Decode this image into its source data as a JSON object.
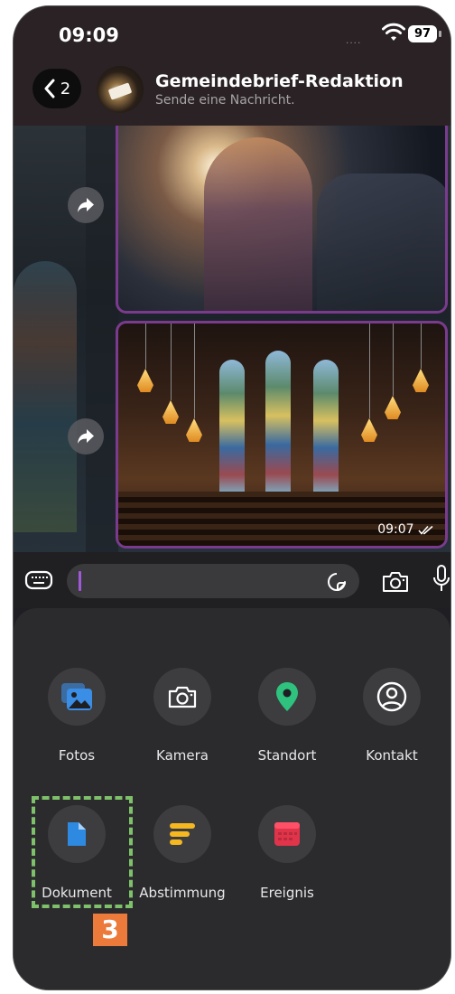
{
  "status_bar": {
    "time": "09:09",
    "signal": "....",
    "battery": "97"
  },
  "header": {
    "back_count": "2",
    "title": "Gemeindebrief-Redaktion",
    "subtitle": "Sende eine Nachricht."
  },
  "messages": [
    {
      "type": "photo",
      "description_icon": "forward-icon"
    },
    {
      "type": "photo",
      "time": "09:07",
      "read_status": "double-check-icon"
    }
  ],
  "input": {
    "value": "",
    "keyboard_icon": "keyboard-icon",
    "sticker_icon": "sticker-icon",
    "camera_icon": "camera-icon",
    "mic_icon": "microphone-icon"
  },
  "attachments": [
    {
      "label": "Fotos",
      "icon": "photos-icon",
      "color": "#3a8ee6"
    },
    {
      "label": "Kamera",
      "icon": "camera-icon",
      "color": "#ffffff"
    },
    {
      "label": "Standort",
      "icon": "location-pin-icon",
      "color": "#2ec27e"
    },
    {
      "label": "Kontakt",
      "icon": "contact-icon",
      "color": "#ffffff"
    },
    {
      "label": "Dokument",
      "icon": "document-icon",
      "color": "#2d8ae0"
    },
    {
      "label": "Abstimmung",
      "icon": "poll-icon",
      "color": "#f5b820"
    },
    {
      "label": "Ereignis",
      "icon": "calendar-icon",
      "color": "#e0344a"
    }
  ],
  "annotation": {
    "step": "3",
    "highlight_color": "#7ec16a",
    "badge_color": "#ec7a3a"
  },
  "colors": {
    "accent": "#a259d9",
    "bubble_border": "#7a3b8e"
  }
}
